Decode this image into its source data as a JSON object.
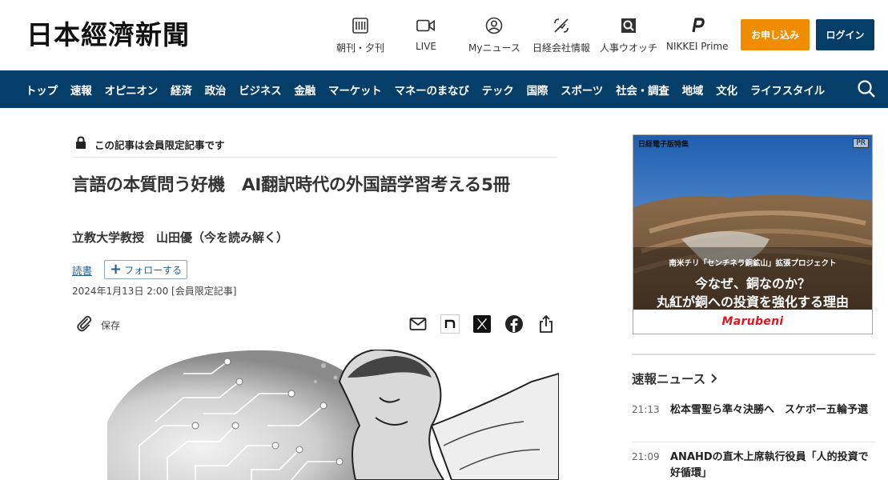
{
  "header": {
    "logo_text": "日本經濟新聞",
    "nav": [
      {
        "label": "朝刊・夕刊",
        "icon": "newspaper-icon"
      },
      {
        "label": "LIVE",
        "icon": "video-camera-icon"
      },
      {
        "label": "Myニュース",
        "icon": "user-icon"
      },
      {
        "label": "日経会社情報",
        "icon": "chart-icon"
      },
      {
        "label": "人事ウオッチ",
        "icon": "magnifier-icon"
      },
      {
        "label": "NIKKEI Prime",
        "icon": "prime-logo-icon"
      }
    ],
    "apply_label": "お申し込み",
    "login_label": "ログイン",
    "colors": {
      "apply": "#f08c00",
      "login": "#063e6a"
    }
  },
  "navbar": {
    "items": [
      "トップ",
      "速報",
      "オピニオン",
      "経済",
      "政治",
      "ビジネス",
      "金融",
      "マーケット",
      "マネーのまなび",
      "テック",
      "国際",
      "スポーツ",
      "社会・調査",
      "地域",
      "文化",
      "ライフスタイル"
    ],
    "background": "#063e6a"
  },
  "article": {
    "members_only": "この記事は会員限定記事です",
    "title": "言語の本質問う好機　AI翻訳時代の外国語学習考える5冊",
    "subtitle": "立教大学教授　山田優（今を読み解く）",
    "reading_link": "読書",
    "follow_label": "フォローする",
    "date": "2024年1月13日 2:00 [会員限定記事]",
    "save_label": "保存",
    "share_icons": [
      "mail-icon",
      "note-icon",
      "x-icon",
      "facebook-icon",
      "share-icon"
    ]
  },
  "sidebar": {
    "ad": {
      "label": "日経電子版特集",
      "pr": "PR",
      "small": "南米チリ「センチネラ銅鉱山」拡張プロジェクト",
      "line1": "今なぜ、銅なのか？",
      "line2": "丸紅が銅への投資を強化する理由",
      "brand": "Marubeni"
    },
    "news_heading": "速報ニュース",
    "news": [
      {
        "time": "21:13",
        "title": "松本雪聖ら準々決勝へ　スケボー五輪予選"
      },
      {
        "time": "21:09",
        "title": "ANAHDの直木上席執行役員「人的投資で好循環」"
      }
    ]
  }
}
